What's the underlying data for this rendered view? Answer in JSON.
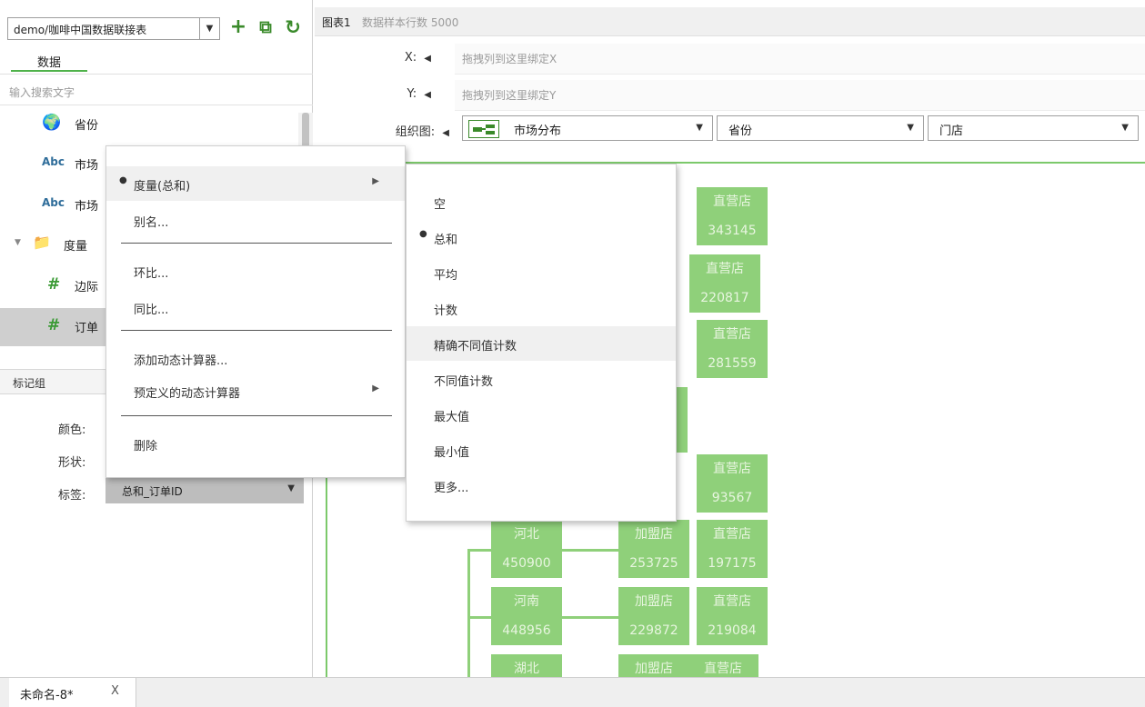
{
  "toolbar": {
    "datasource": "demo/咖啡中国数据联接表",
    "datasource_arrow": "▼",
    "add_icon": "+",
    "popout_icon": "⧉",
    "refresh_icon": "↻"
  },
  "left": {
    "tab_data": "数据",
    "search_placeholder": "输入搜索文字",
    "fields": [
      {
        "icon": "🌍",
        "label": "省份"
      },
      {
        "icon": "Abc",
        "label": "市场"
      },
      {
        "icon": "Abc",
        "label": "市场"
      },
      {
        "icon": "📁",
        "label": "度量"
      },
      {
        "icon": "#",
        "label": "边际"
      },
      {
        "icon": "#",
        "label": "订单"
      }
    ],
    "marks_header": "标记组",
    "marks": {
      "color": "颜色:",
      "shape": "形状:",
      "tag": "标签:",
      "tag_value": "总和_订单ID",
      "tag_arrow": "▼"
    }
  },
  "chart": {
    "name": "图表1",
    "sample_rows": "数据样本行数 5000",
    "x_label": "X:",
    "x_placeholder": "拖拽列到这里绑定X",
    "y_label": "Y:",
    "y_placeholder": "拖拽列到这里绑定Y",
    "org_label": "组织图:",
    "org_fields": [
      "市场分布",
      "省份",
      "门店"
    ],
    "arrow_left": "◀",
    "arrow_down": "▼"
  },
  "nodes": {
    "top": [
      {
        "name": "直营店",
        "value": "343145"
      },
      {
        "name": "直营店",
        "value": "220817"
      },
      {
        "name": "直营店",
        "value": "281559"
      },
      {
        "name": "直营店",
        "value": "93567"
      }
    ],
    "rows": [
      {
        "prov": "河北",
        "prov_val": "450900",
        "a": "加盟店",
        "a_val": "253725",
        "b": "直营店",
        "b_val": "197175"
      },
      {
        "prov": "河南",
        "prov_val": "448956",
        "a": "加盟店",
        "a_val": "229872",
        "b": "直营店",
        "b_val": "219084"
      },
      {
        "prov": "湖北",
        "prov_val": "",
        "a": "加盟店",
        "a_val": "",
        "b": "直营店",
        "b_val": ""
      }
    ]
  },
  "context_menu": {
    "items": [
      "度量(总和)",
      "别名...",
      "环比...",
      "同比...",
      "添加动态计算器...",
      "预定义的动态计算器",
      "删除"
    ],
    "bullet": "●",
    "submenu_arrow": "▶"
  },
  "sub_menu": {
    "items": [
      "空",
      "总和",
      "平均",
      "计数",
      "精确不同值计数",
      "不同值计数",
      "最大值",
      "最小值",
      "更多..."
    ]
  },
  "bottom": {
    "doc_tab": "未命名-8*",
    "close": "X"
  }
}
